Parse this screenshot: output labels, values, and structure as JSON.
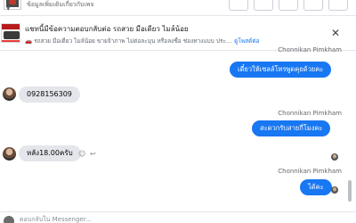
{
  "header": {
    "subtitle": "ข้อมูลเพิ่มเติมเกี่ยวกับเพจ"
  },
  "notice": {
    "title": "แชทนี้มีข้อความตอบกลับต่อ รถสวย มือเดียว ไมล์น้อย",
    "subtitle": "รถสวย มือเดียว ไมล์น้อย ขายจ้าภาพ ไม่ต่อละมุน หรือลงชื่อ ช่องทางแบบ ประ...",
    "link": "ดูโพสต์ต่อ",
    "car_icon": "car-icon",
    "close_icon": "close-icon"
  },
  "messages": [
    {
      "sender": "Chonnikan Pimkham",
      "text": "เดี๋ยวให้เซลล์โทรพูดคุยด้วยคะ",
      "direction": "outgoing"
    },
    {
      "text": "0928156309",
      "direction": "incoming"
    },
    {
      "sender": "Chonnikan Pimkham",
      "text": "สะดวกรับสายกี่โมงคะ",
      "direction": "outgoing"
    },
    {
      "text": "หลัง18.00ครับ",
      "direction": "incoming"
    },
    {
      "sender": "Chonnikan Pimkham",
      "text": "ได้คะ",
      "direction": "outgoing"
    }
  ],
  "composer": {
    "placeholder": "ตอบกลับใน Messenger..."
  },
  "colors": {
    "accent": "#1877f2",
    "incoming_bubble": "#e4e6eb"
  }
}
